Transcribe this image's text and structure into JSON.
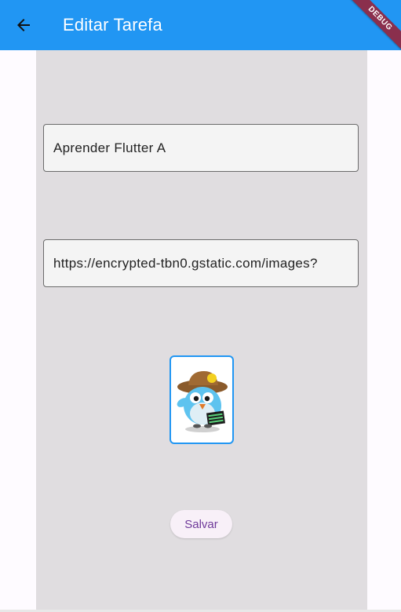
{
  "appbar": {
    "title": "Editar Tarefa",
    "back_icon": "arrow-left-icon",
    "debug_label": "DEBUG",
    "color": "#2196f3"
  },
  "form": {
    "name_value": "Aprender Flutter A",
    "image_url_value": "https://encrypted-tbn0.gstatic.com/images?",
    "save_label": "Salvar"
  },
  "colors": {
    "panel_bg": "#e0dde0",
    "accent": "#2196f3",
    "save_text": "#6f3a9a"
  }
}
